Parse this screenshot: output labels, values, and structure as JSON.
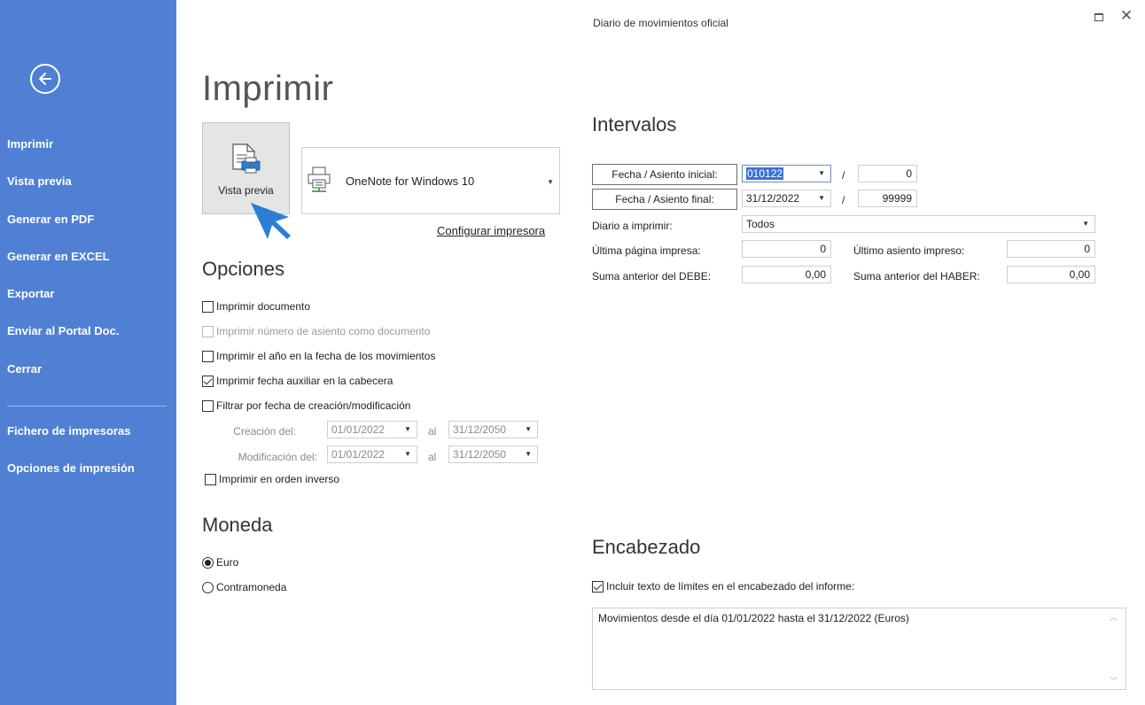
{
  "window": {
    "title": "Diario de movimientos oficial"
  },
  "sidebar": {
    "items": [
      {
        "label": "Imprimir"
      },
      {
        "label": "Vista previa"
      },
      {
        "label": "Generar en PDF"
      },
      {
        "label": "Generar en EXCEL"
      },
      {
        "label": "Exportar"
      },
      {
        "label": "Enviar al Portal Doc."
      },
      {
        "label": "Cerrar"
      }
    ],
    "items2": [
      {
        "label": "Fichero de impresoras"
      },
      {
        "label": "Opciones de impresión"
      }
    ]
  },
  "main": {
    "title": "Imprimir",
    "preview_button": "Vista previa",
    "printer_name": "OneNote for Windows 10",
    "config_link": "Configurar impresora"
  },
  "options": {
    "title": "Opciones",
    "checks": [
      {
        "label": "Imprimir documento",
        "checked": false,
        "disabled": false
      },
      {
        "label": "Imprimir número de asiento como documento",
        "checked": false,
        "disabled": true
      },
      {
        "label": "Imprimir el año en la fecha de los movimientos",
        "checked": false,
        "disabled": false
      },
      {
        "label": "Imprimir fecha auxiliar en la cabecera",
        "checked": true,
        "disabled": false
      },
      {
        "label": "Filtrar por fecha de creación/modificación",
        "checked": false,
        "disabled": false
      }
    ],
    "creation_label": "Creación del:",
    "modification_label": "Modificación del:",
    "al": "al",
    "creation_from": "01/01/2022",
    "creation_to": "31/12/2050",
    "modification_from": "01/01/2022",
    "modification_to": "31/12/2050",
    "reverse_order": {
      "label": "Imprimir en orden inverso",
      "checked": false
    }
  },
  "currency": {
    "title": "Moneda",
    "options": [
      {
        "label": "Euro",
        "selected": true
      },
      {
        "label": "Contramoneda",
        "selected": false
      }
    ]
  },
  "intervals": {
    "title": "Intervalos",
    "start_label": "Fecha / Asiento inicial:",
    "end_label": "Fecha / Asiento final:",
    "start_date": "010122",
    "end_date": "31/12/2022",
    "slash": "/",
    "start_entry": "0",
    "end_entry": "99999",
    "journal_label": "Diario a imprimir:",
    "journal_value": "Todos",
    "last_page_label": "Última página impresa:",
    "last_page_value": "0",
    "last_entry_label": "Último asiento impreso:",
    "last_entry_value": "0",
    "debe_label": "Suma anterior del DEBE:",
    "debe_value": "0,00",
    "haber_label": "Suma anterior del HABER:",
    "haber_value": "0,00"
  },
  "header": {
    "title": "Encabezado",
    "include_label": "Incluir texto de límites en el encabezado del informe:",
    "include_checked": true,
    "text": "Movimientos desde el día 01/01/2022 hasta el 31/12/2022 (Euros)"
  },
  "colors": {
    "sidebar_bg": "#4f80d4",
    "accent": "#2a7fd4"
  }
}
